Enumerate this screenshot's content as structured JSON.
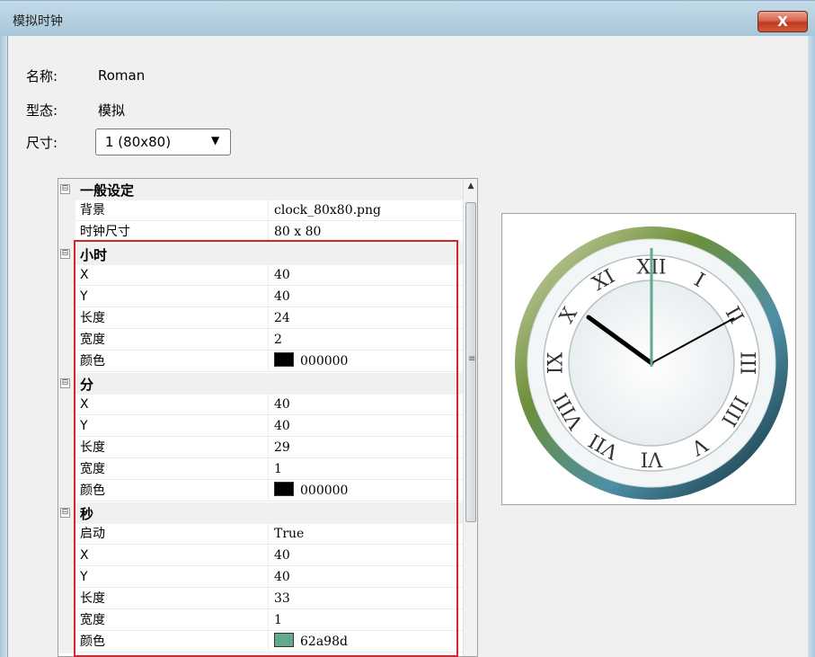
{
  "window": {
    "title": "模拟时钟",
    "close_glyph": "X"
  },
  "info": {
    "name_label": "名称:",
    "name_value": "Roman",
    "type_label": "型态:",
    "type_value": "模拟",
    "size_label": "尺寸:",
    "size_value": "1  (80x80)"
  },
  "grid": {
    "general": {
      "title": "一般设定",
      "background_label": "背景",
      "background_value": "clock_80x80.png",
      "clock_size_label": "时钟尺寸",
      "clock_size_value": "80 x 80"
    },
    "hour": {
      "title": "小时",
      "x_label": "X",
      "x_value": "40",
      "y_label": "Y",
      "y_value": "40",
      "length_label": "长度",
      "length_value": "24",
      "width_label": "宽度",
      "width_value": "2",
      "color_label": "颜色",
      "color_value": "000000",
      "color_hex": "#000000"
    },
    "minute": {
      "title": "分",
      "x_label": "X",
      "x_value": "40",
      "y_label": "Y",
      "y_value": "40",
      "length_label": "长度",
      "length_value": "29",
      "width_label": "宽度",
      "width_value": "1",
      "color_label": "颜色",
      "color_value": "000000",
      "color_hex": "#000000"
    },
    "second": {
      "title": "秒",
      "enable_label": "启动",
      "enable_value": "True",
      "x_label": "X",
      "x_value": "40",
      "y_label": "Y",
      "y_value": "40",
      "length_label": "长度",
      "length_value": "33",
      "width_label": "宽度",
      "width_value": "1",
      "color_label": "颜色",
      "color_value": "62a98d",
      "color_hex": "#62a98d"
    },
    "collapse_glyph": "⊟",
    "scroll_up_glyph": "▲",
    "scroll_grip_glyph": "≡"
  },
  "preview": {
    "numerals": [
      "XII",
      "I",
      "II",
      "III",
      "IIII",
      "V",
      "VI",
      "VII",
      "VIII",
      "IX",
      "X",
      "XI"
    ],
    "hand_colors": {
      "hour": "#000000",
      "minute": "#000000",
      "second": "#62a98d"
    }
  },
  "colors": {
    "highlight": "#d7262a",
    "titlebar": "#b3cfdf",
    "close": "#c0391f"
  }
}
